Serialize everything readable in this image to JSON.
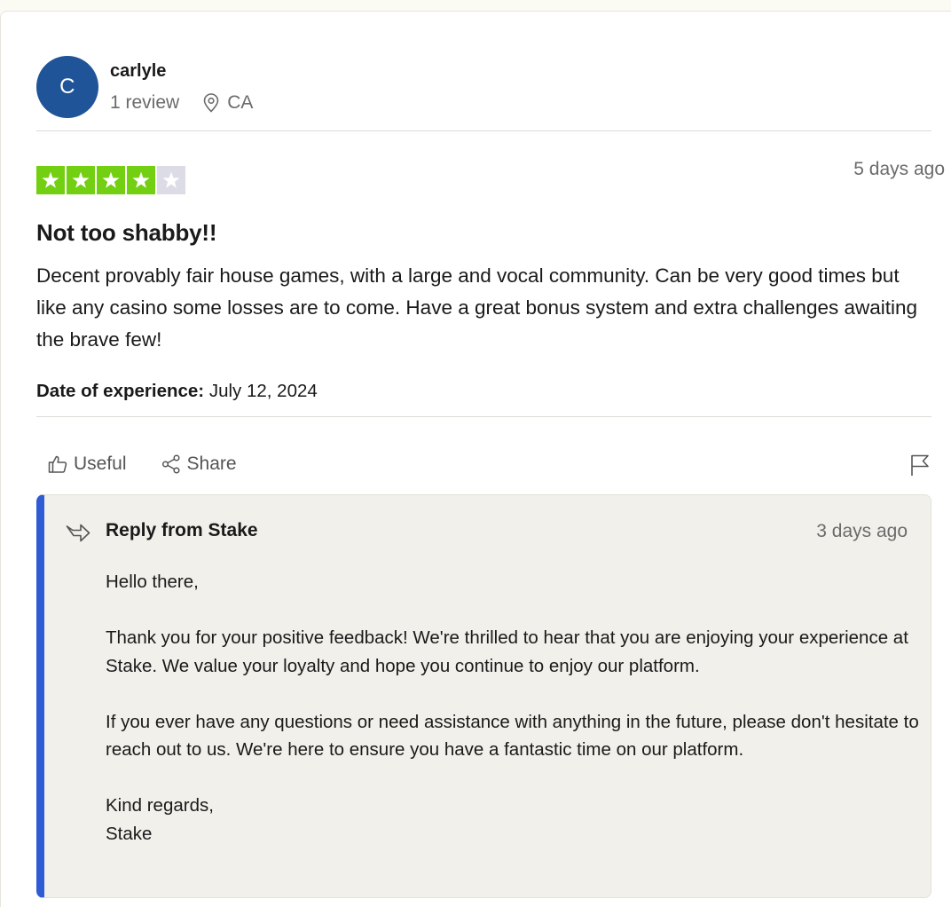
{
  "reviewer": {
    "avatar_initial": "C",
    "name": "carlyle",
    "review_count": "1 review",
    "location": "CA"
  },
  "review": {
    "rating": 4,
    "max_rating": 5,
    "date": "5 days ago",
    "title": "Not too shabby!!",
    "body": "Decent provably fair house games, with a large and vocal community. Can be very good times but like any casino some losses are to come. Have a great bonus system and extra challenges awaiting the brave few!",
    "experience_label": "Date of experience:",
    "experience_date": "July 12, 2024"
  },
  "actions": {
    "useful_label": "Useful",
    "share_label": "Share"
  },
  "reply": {
    "from": "Reply from Stake",
    "date": "3 days ago",
    "paragraphs": [
      "Hello there,",
      "Thank you for your positive feedback! We're thrilled to hear that you are enjoying your experience at Stake. We value your loyalty and hope you continue to enjoy our platform.",
      "If you ever have any questions or need assistance with anything in the future, please don't hesitate to reach out to us. We're here to ensure you have a fantastic time on our platform.",
      "Kind regards,\nStake"
    ]
  },
  "colors": {
    "avatar_bg": "#1f5499",
    "star_filled": "#73cf11",
    "star_empty": "#dcdce6",
    "reply_accent": "#2f5bd4",
    "reply_bg": "#f1f0eb"
  },
  "icons": {
    "location": "map-pin-icon",
    "useful": "thumbs-up-icon",
    "share": "share-icon",
    "flag": "flag-icon",
    "reply": "reply-arrow-icon",
    "star": "star-icon"
  }
}
